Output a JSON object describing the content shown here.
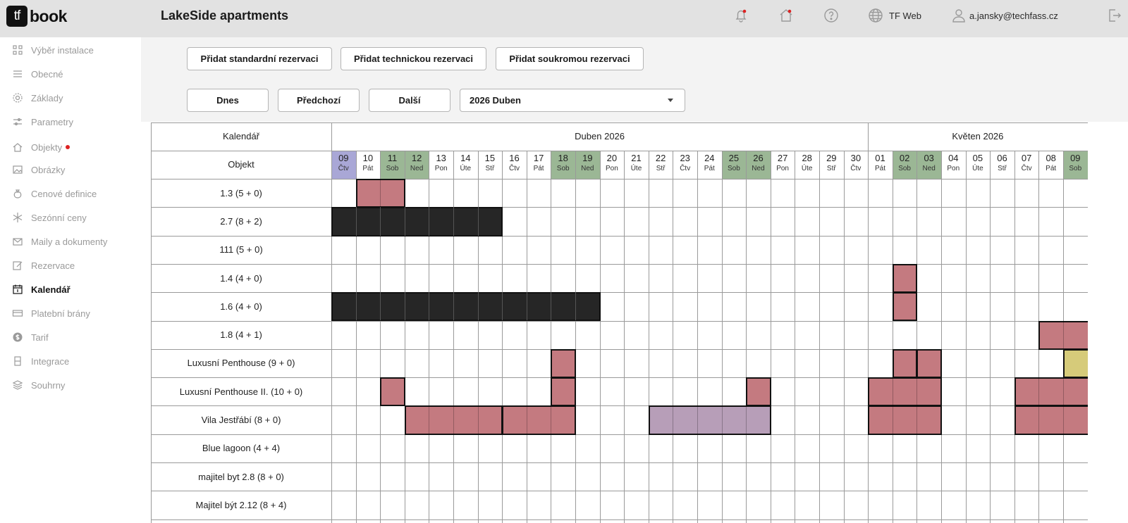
{
  "header": {
    "logo_tf": "tf",
    "logo_word": "book",
    "title": "LakeSide apartments",
    "web_label": "TF Web",
    "user_email": "a.jansky@techfass.cz",
    "icons": [
      "bell-icon",
      "home-icon",
      "help-icon",
      "globe-icon",
      "user-icon",
      "logout-icon"
    ]
  },
  "sidebar": {
    "items": [
      {
        "label": "Výběr instalace",
        "icon": "grid-icon",
        "active": false
      },
      {
        "label": "Obecné",
        "icon": "menu-lines-icon",
        "active": false
      },
      {
        "label": "Základy",
        "icon": "gear-icon",
        "active": false
      },
      {
        "label": "Parametry",
        "icon": "sliders-icon",
        "active": false
      },
      {
        "label": "Objekty",
        "icon": "home-icon",
        "active": false,
        "badge": true
      },
      {
        "label": "Obrázky",
        "icon": "image-icon",
        "active": false
      },
      {
        "label": "Cenové definice",
        "icon": "money-bag-icon",
        "active": false
      },
      {
        "label": "Sezónní ceny",
        "icon": "snowflake-icon",
        "active": false
      },
      {
        "label": "Maily a dokumenty",
        "icon": "mail-icon",
        "active": false
      },
      {
        "label": "Rezervace",
        "icon": "edit-icon",
        "active": false
      },
      {
        "label": "Kalendář",
        "icon": "calendar-icon",
        "active": true
      },
      {
        "label": "Platební brány",
        "icon": "card-icon",
        "active": false
      },
      {
        "label": "Tarif",
        "icon": "dollar-icon",
        "active": false
      },
      {
        "label": "Integrace",
        "icon": "plug-icon",
        "active": false
      },
      {
        "label": "Souhrny",
        "icon": "layers-icon",
        "active": false
      }
    ]
  },
  "toolbar": {
    "add_standard": "Přidat standardní rezervaci",
    "add_technical": "Přidat technickou rezervaci",
    "add_private": "Přidat soukromou rezervaci",
    "today": "Dnes",
    "previous": "Předchozí",
    "next": "Další",
    "month_select": "2026 Duben"
  },
  "calendar": {
    "header_label": "Kalendář",
    "object_label": "Objekt",
    "months": [
      {
        "label": "Duben 2026",
        "start": 0,
        "span": 22
      },
      {
        "label": "Květen 2026",
        "start": 22,
        "span": 9
      }
    ],
    "days": [
      {
        "d": "09",
        "w": "Čtv",
        "type": "today"
      },
      {
        "d": "10",
        "w": "Pát",
        "type": ""
      },
      {
        "d": "11",
        "w": "Sob",
        "type": "weekend"
      },
      {
        "d": "12",
        "w": "Ned",
        "type": "weekend"
      },
      {
        "d": "13",
        "w": "Pon",
        "type": ""
      },
      {
        "d": "14",
        "w": "Úte",
        "type": ""
      },
      {
        "d": "15",
        "w": "Stř",
        "type": ""
      },
      {
        "d": "16",
        "w": "Čtv",
        "type": ""
      },
      {
        "d": "17",
        "w": "Pát",
        "type": ""
      },
      {
        "d": "18",
        "w": "Sob",
        "type": "weekend"
      },
      {
        "d": "19",
        "w": "Ned",
        "type": "weekend"
      },
      {
        "d": "20",
        "w": "Pon",
        "type": ""
      },
      {
        "d": "21",
        "w": "Úte",
        "type": ""
      },
      {
        "d": "22",
        "w": "Stř",
        "type": ""
      },
      {
        "d": "23",
        "w": "Čtv",
        "type": ""
      },
      {
        "d": "24",
        "w": "Pát",
        "type": ""
      },
      {
        "d": "25",
        "w": "Sob",
        "type": "weekend"
      },
      {
        "d": "26",
        "w": "Ned",
        "type": "weekend"
      },
      {
        "d": "27",
        "w": "Pon",
        "type": ""
      },
      {
        "d": "28",
        "w": "Úte",
        "type": ""
      },
      {
        "d": "29",
        "w": "Stř",
        "type": ""
      },
      {
        "d": "30",
        "w": "Čtv",
        "type": ""
      },
      {
        "d": "01",
        "w": "Pát",
        "type": ""
      },
      {
        "d": "02",
        "w": "Sob",
        "type": "weekend"
      },
      {
        "d": "03",
        "w": "Ned",
        "type": "weekend"
      },
      {
        "d": "04",
        "w": "Pon",
        "type": ""
      },
      {
        "d": "05",
        "w": "Úte",
        "type": ""
      },
      {
        "d": "06",
        "w": "Stř",
        "type": ""
      },
      {
        "d": "07",
        "w": "Čtv",
        "type": ""
      },
      {
        "d": "08",
        "w": "Pát",
        "type": ""
      },
      {
        "d": "09",
        "w": "Sob",
        "type": "weekend"
      }
    ],
    "objects": [
      "1.3 (5 + 0)",
      "2.7 (8 + 2)",
      "111 (5 + 0)",
      "1.4 (4 + 0)",
      "1.6 (4 + 0)",
      "1.8 (4 + 1)",
      "Luxusní Penthouse (9 + 0)",
      "Luxusní Penthouse II. (10 + 0)",
      "Vila Jestřábí (8 + 0)",
      "Blue lagoon (4 + 4)",
      "majitel byt 2.8 (8 + 0)",
      "Majitel být 2.12 (8 + 4)"
    ],
    "reservations": [
      {
        "row": 0,
        "start": 1,
        "end": 3,
        "kind": "pink"
      },
      {
        "row": 1,
        "start": 0,
        "end": 7,
        "kind": "black"
      },
      {
        "row": 3,
        "start": 23,
        "end": 24,
        "kind": "pink"
      },
      {
        "row": 4,
        "start": 0,
        "end": 11,
        "kind": "black"
      },
      {
        "row": 4,
        "start": 23,
        "end": 24,
        "kind": "pink"
      },
      {
        "row": 5,
        "start": 29,
        "end": 31,
        "kind": "pink"
      },
      {
        "row": 6,
        "start": 9,
        "end": 10,
        "kind": "pink"
      },
      {
        "row": 6,
        "start": 23,
        "end": 24,
        "kind": "pink"
      },
      {
        "row": 6,
        "start": 24,
        "end": 25,
        "kind": "pink"
      },
      {
        "row": 6,
        "start": 30,
        "end": 31,
        "kind": "yellow"
      },
      {
        "row": 7,
        "start": 2,
        "end": 3,
        "kind": "pink"
      },
      {
        "row": 7,
        "start": 9,
        "end": 10,
        "kind": "pink"
      },
      {
        "row": 7,
        "start": 17,
        "end": 18,
        "kind": "pink"
      },
      {
        "row": 7,
        "start": 22,
        "end": 25,
        "kind": "pink"
      },
      {
        "row": 7,
        "start": 28,
        "end": 31,
        "kind": "pink"
      },
      {
        "row": 8,
        "start": 3,
        "end": 7,
        "kind": "pink"
      },
      {
        "row": 8,
        "start": 7,
        "end": 10,
        "kind": "pink"
      },
      {
        "row": 8,
        "start": 13,
        "end": 18,
        "kind": "purple"
      },
      {
        "row": 8,
        "start": 22,
        "end": 25,
        "kind": "pink"
      },
      {
        "row": 8,
        "start": 28,
        "end": 31,
        "kind": "pink"
      }
    ]
  }
}
